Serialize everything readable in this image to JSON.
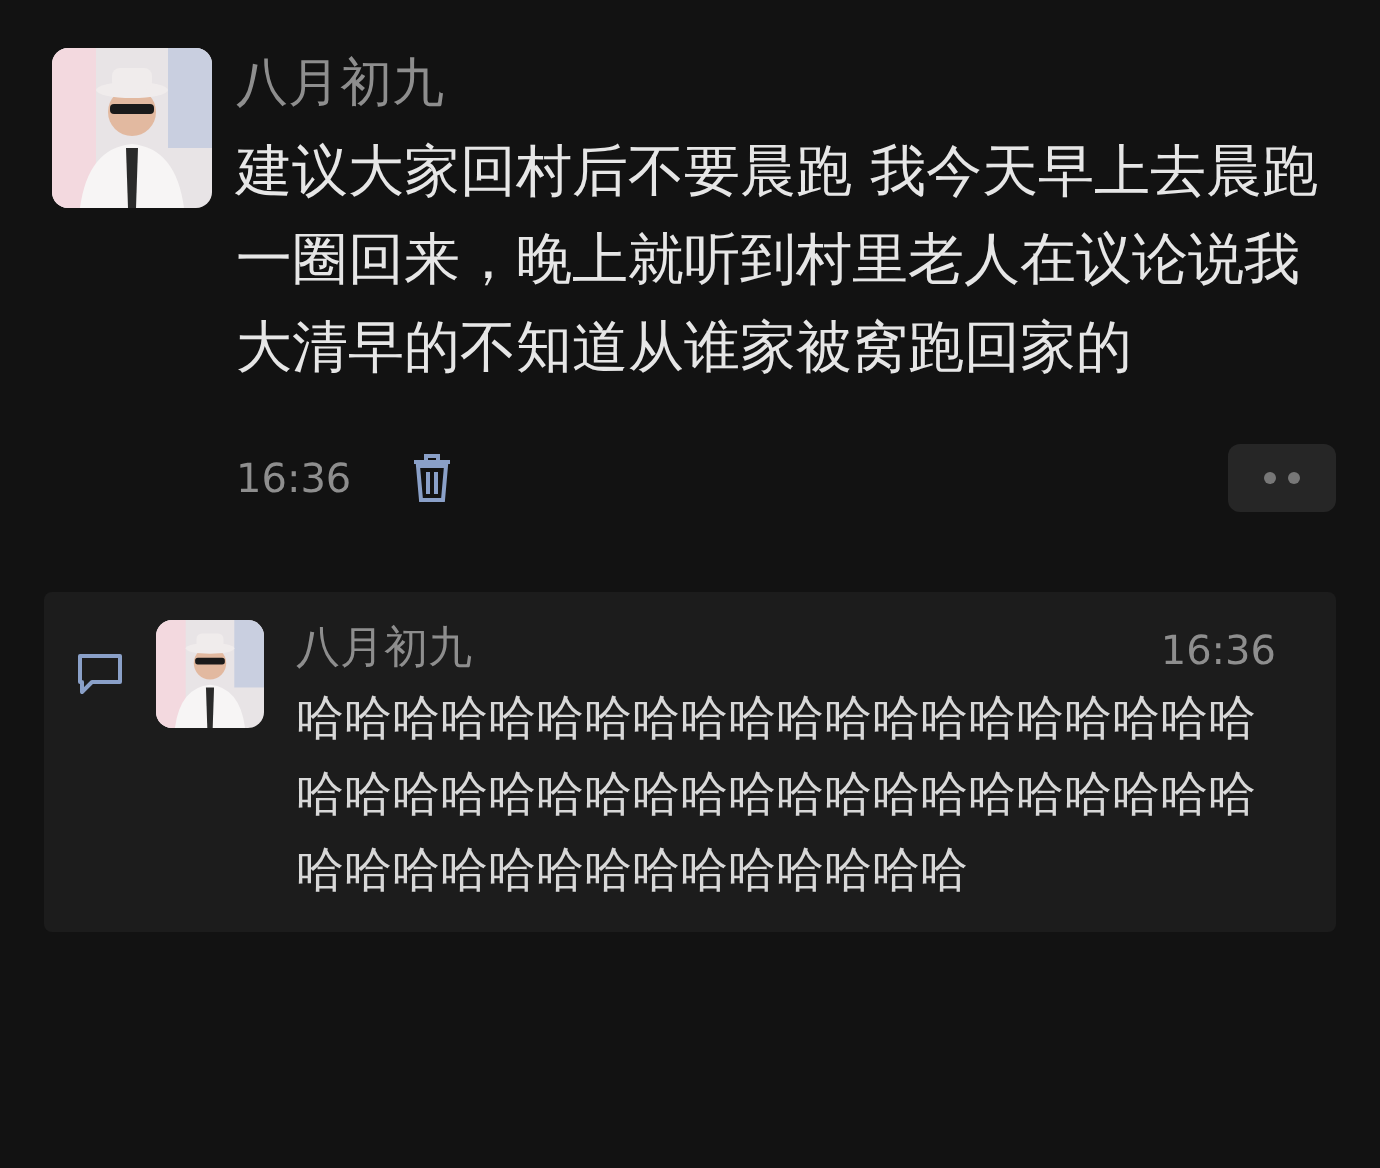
{
  "post": {
    "author": "八月初九",
    "text": "建议大家回村后不要晨跑 我今天早上去晨跑一圈回来，晚上就听到村里老人在议论说我大清早的不知道从谁家被窝跑回家的",
    "time": "16:36"
  },
  "reply": {
    "author": "八月初九",
    "time": "16:36",
    "text": "哈哈哈哈哈哈哈哈哈哈哈哈哈哈哈哈哈哈哈哈哈哈哈哈哈哈哈哈哈哈哈哈哈哈哈哈哈哈哈哈哈哈哈哈哈哈哈哈哈哈哈哈哈哈"
  }
}
